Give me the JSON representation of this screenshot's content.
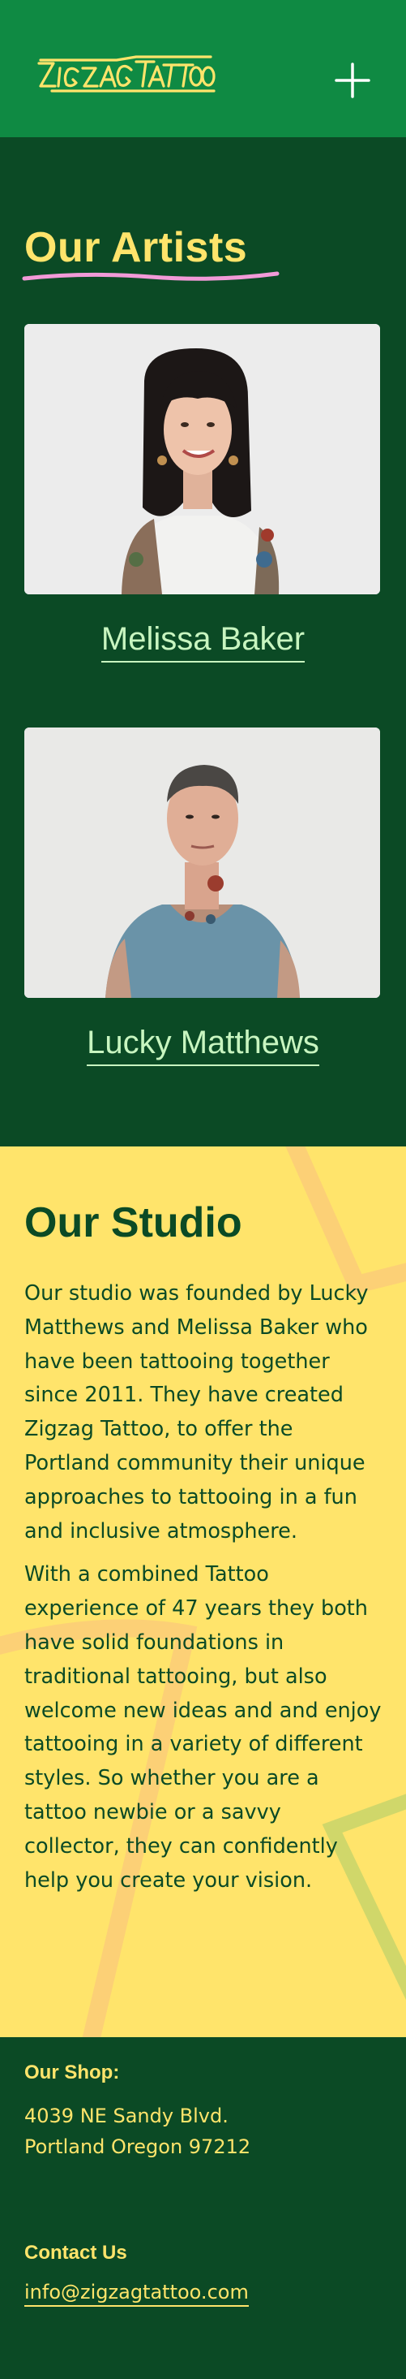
{
  "header": {
    "logo_text": "ZIGZAG TATTOO",
    "menu_icon": "plus-icon"
  },
  "artists": {
    "title": "Our Artists",
    "list": [
      {
        "name": "Melissa Baker"
      },
      {
        "name": "Lucky Matthews"
      }
    ]
  },
  "studio": {
    "title": "Our Studio",
    "paragraphs": [
      "Our studio was founded by Lucky Matthews and Melissa Baker who have been tattooing together since 2011. They have created Zigzag Tattoo, to offer the Portland community their unique approaches to tattooing in a fun and inclusive atmosphere.",
      "With a combined Tattoo experience of 47 years they both have solid foundations in traditional tattooing, but also welcome new ideas and and enjoy tattooing in a variety of different styles. So whether you are a tattoo newbie or a savvy collector, they can confidently help you create your vision."
    ]
  },
  "footer": {
    "shop_heading": "Our Shop:",
    "address_line1": "4039 NE Sandy Blvd.",
    "address_line2": "Portland Oregon 97212",
    "contact_heading": "Contact Us",
    "email": "info@zigzagtattoo.com"
  },
  "colors": {
    "header_green": "#0f8a43",
    "dark_green": "#0b4a25",
    "yellow": "#ffe46b",
    "mint": "#c8f5c0",
    "pink_accent": "#f29ad8"
  }
}
